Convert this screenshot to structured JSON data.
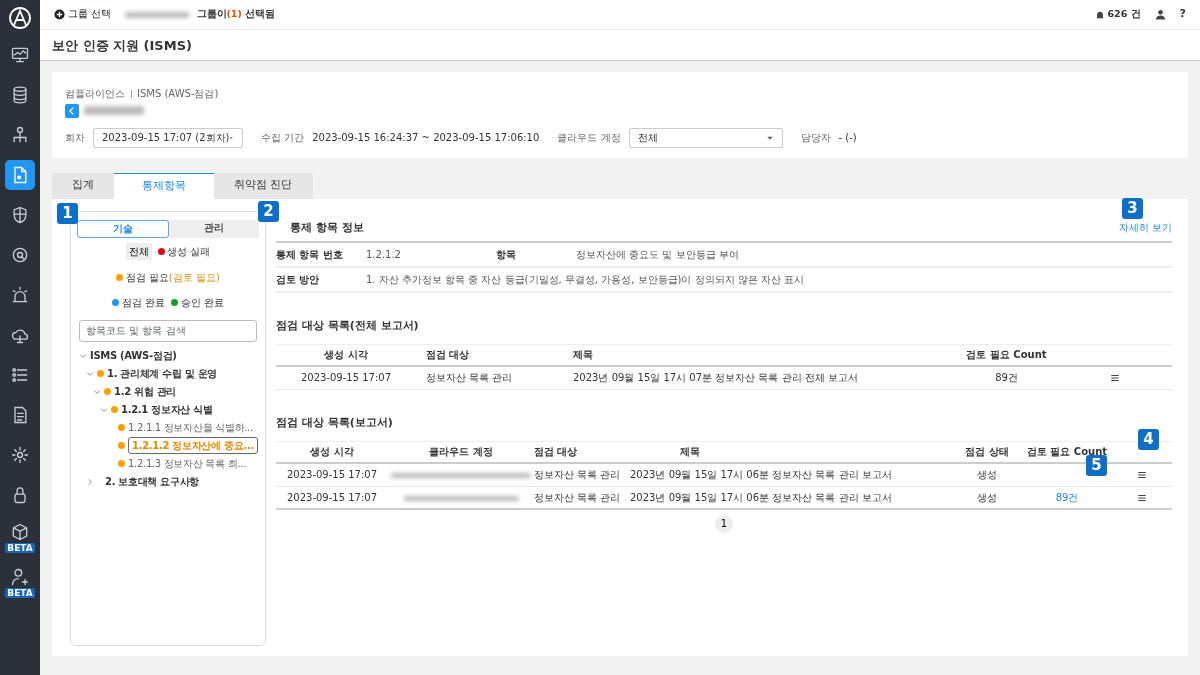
{
  "sidebar": {
    "items": [
      {
        "kind": "monitor",
        "selected": false
      },
      {
        "kind": "database",
        "selected": false
      },
      {
        "kind": "network",
        "selected": false
      },
      {
        "kind": "document",
        "selected": true
      },
      {
        "kind": "shield",
        "selected": false
      },
      {
        "kind": "search",
        "selected": false
      },
      {
        "kind": "alarm",
        "selected": false
      },
      {
        "kind": "cloud",
        "selected": false
      },
      {
        "kind": "list",
        "selected": false
      },
      {
        "kind": "file",
        "selected": false
      },
      {
        "kind": "gear",
        "selected": false
      },
      {
        "kind": "lock",
        "selected": false
      },
      {
        "kind": "cube",
        "selected": false,
        "badge": "BETA"
      },
      {
        "kind": "person",
        "selected": false,
        "badge": "BETA"
      }
    ]
  },
  "topbar": {
    "group_button": "그룹 선택",
    "group_status": {
      "prefix": "그룹이",
      "count": "(1)",
      "suffix": "선택됨"
    },
    "alerts": "626 건",
    "help": "?"
  },
  "page_title": "보안 인증 지원 (ISMS)",
  "breadcrumb": [
    "컴플라이언스",
    "ISMS (AWS-점검)"
  ],
  "filters": [
    {
      "kind": "select",
      "label": "회차",
      "value": "2023-09-15 17:07 (2회차)"
    },
    {
      "kind": "text",
      "label": "수집 기간",
      "value": "2023-09-15 16:24:37 ~ 2023-09-15 17:06:10"
    },
    {
      "kind": "select",
      "label": "클라우드 계정",
      "value": "전체"
    },
    {
      "kind": "text",
      "label": "담당자",
      "value": "- (-)"
    }
  ],
  "tabs": [
    {
      "label": "집계",
      "selected": false
    },
    {
      "label": "통제항목",
      "selected": true
    },
    {
      "label": "취약점 진단",
      "selected": false
    }
  ],
  "tree_panel": {
    "toggle": [
      {
        "label": "기술",
        "selected": true
      },
      {
        "label": "관리",
        "selected": false
      }
    ],
    "legend": [
      {
        "kind": "all",
        "label": "전체"
      },
      {
        "kind": "status",
        "label": "생성 실패",
        "color": "#e60012"
      },
      {
        "kind": "status",
        "label": "점검 필요",
        "note": "(검토 필요)",
        "color": "#ff9f00"
      },
      {
        "kind": "status",
        "label": "점검 완료",
        "color": "#2196f3"
      },
      {
        "kind": "status",
        "label": "승인 완료",
        "color": "#1a9e2a"
      }
    ],
    "search": {
      "placeholder": "항목코드 및 항목 검색"
    },
    "tree": [
      {
        "label": "ISMS (AWS-점검)",
        "expanded": true,
        "selected": false,
        "children": [
          {
            "label": "1. 관리체계 수립 및 운영",
            "expanded": true,
            "selected": false,
            "color": "#ff9f00",
            "children": [
              {
                "label": "1.2 위험 관리",
                "expanded": true,
                "selected": false,
                "color": "#ff9f00",
                "children": [
                  {
                    "label": "1.2.1 정보자산 식별",
                    "expanded": true,
                    "selected": false,
                    "color": "#ff9f00",
                    "children": [
                      {
                        "label": "1.2.1.1 정보자산을 식별하...",
                        "selected": false,
                        "color": "#ff9f00"
                      },
                      {
                        "label": "1.2.1.2 정보자산에 중요...",
                        "selected": true,
                        "color": "#ff9f00"
                      },
                      {
                        "label": "1.2.1.3 정보자산 목록 최...",
                        "selected": false,
                        "color": "#ff9f00"
                      }
                    ]
                  }
                ]
              }
            ]
          },
          {
            "label": "2. 보호대책 요구사항",
            "expanded": false,
            "selected": false
          }
        ]
      }
    ]
  },
  "info": {
    "title": "통제 항목 정보",
    "detail_link": "자세히 보기",
    "rows": [
      [
        {
          "label": "통제 항목 번호",
          "value": "1.2.1.2"
        },
        {
          "label": "항목",
          "value": "정보자산에 중요도 및 보안등급 부여"
        }
      ],
      [
        {
          "label": "검토 방안",
          "value": "1. 자산 추가정보 항목 중 자산 등급(기밀성, 무결성, 가용성, 보안등급)이 정의되지 않은 자산 표시"
        }
      ]
    ]
  },
  "full_report": {
    "title": "점검 대상 목록(전체 보고서)",
    "columns": [
      "생성 시각",
      "점검 대상",
      "제목",
      "검토 필요 Count"
    ],
    "rows": [
      {
        "created": "2023-09-15 17:07",
        "target": "정보자산 목록 관리",
        "title": "2023년 09월 15일 17시 07분 정보자산 목록 관리 전체 보고서",
        "count": "89건"
      }
    ]
  },
  "reports": {
    "title": "점검 대상 목록(보고서)",
    "columns": [
      "생성 시각",
      "클라우드 계정",
      "점검 대상",
      "제목",
      "점검 상태",
      "검토 필요 Count"
    ],
    "rows": [
      {
        "created": "2023-09-15 17:07",
        "target": "정보자산 목록 관리",
        "title": "2023년 09월 15일 17시 06분 정보자산 목록 관리 보고서",
        "status": "생성"
      },
      {
        "created": "2023-09-15 17:07",
        "target": "정보자산 목록 관리",
        "title": "2023년 09월 15일 17시 06분 정보자산 목록 관리 보고서",
        "status": "생성",
        "count": "89건"
      }
    ],
    "pages": [
      {
        "label": "1",
        "selected": true
      }
    ]
  },
  "callouts": [
    "1",
    "2",
    "3",
    "4",
    "5"
  ]
}
